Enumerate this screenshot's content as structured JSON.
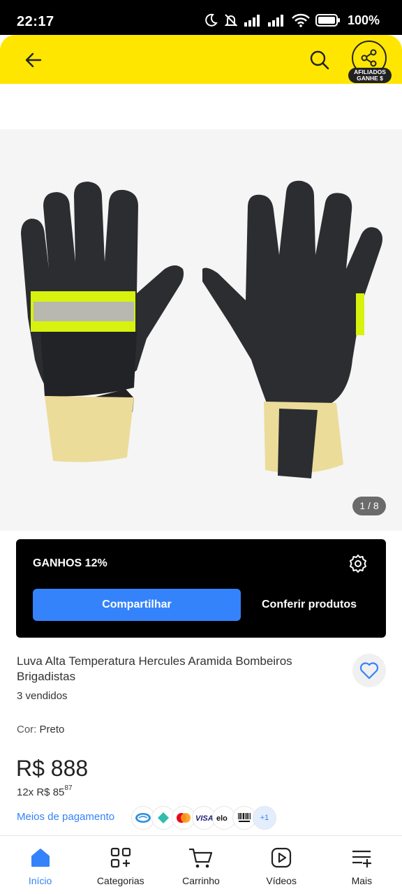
{
  "status_bar": {
    "time": "22:17",
    "battery": "100%"
  },
  "header": {
    "back_icon": "arrow-left-icon",
    "search_icon": "search-icon",
    "share_icon": "share-icon",
    "afiliados_line1": "AFILIADOS",
    "afiliados_line2": "GANHE $",
    "background_color": "#fee600"
  },
  "gallery": {
    "counter": "1 / 8"
  },
  "affiliate": {
    "title": "GANHOS 12%",
    "share_label": "Compartilhar",
    "check_label": "Conferir produtos",
    "accent_color": "#3483fa"
  },
  "product": {
    "title": "Luva Alta Temperatura Hercules Aramida Bombeiros Brigadistas",
    "sold": "3 vendidos",
    "color_label": "Cor:",
    "color_value": "Preto",
    "price": "R$ 888",
    "installments_prefix": "12x R$ 85",
    "installments_cents": "87",
    "payment_link": "Meios de pagamento",
    "payment_more": "+1"
  },
  "bottom_nav": {
    "items": [
      {
        "label": "Início",
        "icon": "home-icon"
      },
      {
        "label": "Categorias",
        "icon": "categories-icon"
      },
      {
        "label": "Carrinho",
        "icon": "cart-icon"
      },
      {
        "label": "Vídeos",
        "icon": "video-icon"
      },
      {
        "label": "Mais",
        "icon": "menu-icon"
      }
    ]
  }
}
